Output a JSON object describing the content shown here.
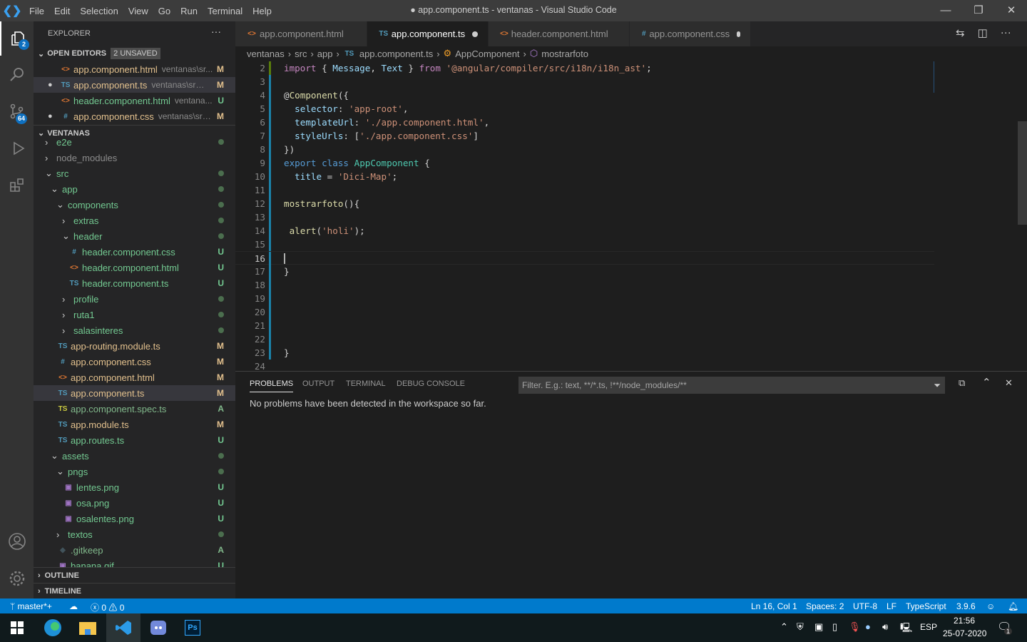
{
  "titlebar": {
    "menus": [
      "File",
      "Edit",
      "Selection",
      "View",
      "Go",
      "Run",
      "Terminal",
      "Help"
    ],
    "title": "● app.component.ts - ventanas - Visual Studio Code"
  },
  "activity": {
    "explorer_badge": "2",
    "scm_badge": "64"
  },
  "sidebar": {
    "title": "EXPLORER",
    "more": "···",
    "open_editors": {
      "label": "OPEN EDITORS",
      "badge": "2 UNSAVED",
      "items": [
        {
          "icon": "<>",
          "iconColor": "#e37933",
          "name": "app.component.html",
          "desc": "ventanas\\sr...",
          "status": "M",
          "color": "#e2c08d",
          "dirty": false
        },
        {
          "icon": "TS",
          "iconColor": "#519aba",
          "name": "app.component.ts",
          "desc": "ventanas\\src\\a...",
          "status": "M",
          "color": "#e2c08d",
          "dirty": true
        },
        {
          "icon": "<>",
          "iconColor": "#e37933",
          "name": "header.component.html",
          "desc": "ventana...",
          "status": "U",
          "color": "#73c991",
          "dirty": false
        },
        {
          "icon": "#",
          "iconColor": "#519aba",
          "name": "app.component.css",
          "desc": "ventanas\\src\\...",
          "status": "M",
          "color": "#e2c08d",
          "dirty": true
        }
      ]
    },
    "workspace": "VENTANAS",
    "tree": [
      {
        "name": "e2e",
        "depth": 1,
        "type": "folder",
        "open": false,
        "color": "#73c991",
        "status": "dot"
      },
      {
        "name": "node_modules",
        "depth": 1,
        "type": "folder",
        "open": false,
        "color": "#8c8c8c",
        "status": ""
      },
      {
        "name": "src",
        "depth": 1,
        "type": "folder",
        "open": true,
        "color": "#73c991",
        "status": "dot"
      },
      {
        "name": "app",
        "depth": 2,
        "type": "folder",
        "open": true,
        "color": "#73c991",
        "status": "dot"
      },
      {
        "name": "components",
        "depth": 3,
        "type": "folder",
        "open": true,
        "color": "#73c991",
        "status": "dot"
      },
      {
        "name": "extras",
        "depth": 4,
        "type": "folder",
        "open": false,
        "color": "#73c991",
        "status": "dot"
      },
      {
        "name": "header",
        "depth": 4,
        "type": "folder",
        "open": true,
        "color": "#73c991",
        "status": "dot"
      },
      {
        "name": "header.component.css",
        "depth": 5,
        "type": "file",
        "icon": "#",
        "iconColor": "#519aba",
        "color": "#73c991",
        "status": "U"
      },
      {
        "name": "header.component.html",
        "depth": 5,
        "type": "file",
        "icon": "<>",
        "iconColor": "#e37933",
        "color": "#73c991",
        "status": "U"
      },
      {
        "name": "header.component.ts",
        "depth": 5,
        "type": "file",
        "icon": "TS",
        "iconColor": "#519aba",
        "color": "#73c991",
        "status": "U"
      },
      {
        "name": "profile",
        "depth": 4,
        "type": "folder",
        "open": false,
        "color": "#73c991",
        "status": "dot"
      },
      {
        "name": "ruta1",
        "depth": 4,
        "type": "folder",
        "open": false,
        "color": "#73c991",
        "status": "dot"
      },
      {
        "name": "salasinteres",
        "depth": 4,
        "type": "folder",
        "open": false,
        "color": "#73c991",
        "status": "dot"
      },
      {
        "name": "app-routing.module.ts",
        "depth": 3,
        "type": "file",
        "icon": "TS",
        "iconColor": "#519aba",
        "color": "#e2c08d",
        "status": "M"
      },
      {
        "name": "app.component.css",
        "depth": 3,
        "type": "file",
        "icon": "#",
        "iconColor": "#519aba",
        "color": "#e2c08d",
        "status": "M"
      },
      {
        "name": "app.component.html",
        "depth": 3,
        "type": "file",
        "icon": "<>",
        "iconColor": "#e37933",
        "color": "#e2c08d",
        "status": "M"
      },
      {
        "name": "app.component.ts",
        "depth": 3,
        "type": "file",
        "icon": "TS",
        "iconColor": "#519aba",
        "color": "#e2c08d",
        "status": "M",
        "selected": true
      },
      {
        "name": "app.component.spec.ts",
        "depth": 3,
        "type": "file",
        "icon": "TS",
        "iconColor": "#cbcb41",
        "color": "#81b88b",
        "status": "A"
      },
      {
        "name": "app.module.ts",
        "depth": 3,
        "type": "file",
        "icon": "TS",
        "iconColor": "#519aba",
        "color": "#e2c08d",
        "status": "M"
      },
      {
        "name": "app.routes.ts",
        "depth": 3,
        "type": "file",
        "icon": "TS",
        "iconColor": "#519aba",
        "color": "#73c991",
        "status": "U"
      },
      {
        "name": "assets",
        "depth": 2,
        "type": "folder",
        "open": true,
        "color": "#73c991",
        "status": "dot"
      },
      {
        "name": "pngs",
        "depth": 3,
        "type": "folder",
        "open": true,
        "color": "#73c991",
        "status": "dot"
      },
      {
        "name": "lentes.png",
        "depth": 4,
        "type": "file",
        "icon": "▣",
        "iconColor": "#a074c4",
        "color": "#73c991",
        "status": "U"
      },
      {
        "name": "osa.png",
        "depth": 4,
        "type": "file",
        "icon": "▣",
        "iconColor": "#a074c4",
        "color": "#73c991",
        "status": "U"
      },
      {
        "name": "osalentes.png",
        "depth": 4,
        "type": "file",
        "icon": "▣",
        "iconColor": "#a074c4",
        "color": "#73c991",
        "status": "U"
      },
      {
        "name": "textos",
        "depth": 3,
        "type": "folder",
        "open": false,
        "color": "#73c991",
        "status": "dot"
      },
      {
        "name": ".gitkeep",
        "depth": 3,
        "type": "file",
        "icon": "◆",
        "iconColor": "#41535b",
        "color": "#81b88b",
        "status": "A"
      },
      {
        "name": "banana.gif",
        "depth": 3,
        "type": "file",
        "icon": "▣",
        "iconColor": "#a074c4",
        "color": "#73c991",
        "status": "U"
      }
    ],
    "outline": "OUTLINE",
    "timeline": "TIMELINE"
  },
  "tabs": [
    {
      "icon": "<>",
      "iconColor": "#e37933",
      "label": "app.component.html",
      "active": false,
      "dirty": false
    },
    {
      "icon": "TS",
      "iconColor": "#519aba",
      "label": "app.component.ts",
      "active": true,
      "dirty": true
    },
    {
      "icon": "<>",
      "iconColor": "#e37933",
      "label": "header.component.html",
      "active": false,
      "dirty": false
    },
    {
      "icon": "#",
      "iconColor": "#519aba",
      "label": "app.component.css",
      "active": false,
      "dirty": true
    }
  ],
  "breadcrumb": [
    "ventanas",
    "src",
    "app",
    "app.component.ts",
    "AppComponent",
    "mostrarfoto"
  ],
  "code": [
    {
      "n": 2,
      "tokens": [
        [
          "import",
          "#c586c0"
        ],
        [
          " { ",
          "#d4d4d4"
        ],
        [
          "Message",
          "#9cdcfe"
        ],
        [
          ", ",
          "#d4d4d4"
        ],
        [
          "Text",
          "#9cdcfe"
        ],
        [
          " } ",
          "#d4d4d4"
        ],
        [
          "from",
          "#c586c0"
        ],
        [
          " ",
          "#d4d4d4"
        ],
        [
          "'@angular/compiler/src/i18n/i18n_ast'",
          "#ce9178"
        ],
        [
          ";",
          "#d4d4d4"
        ]
      ]
    },
    {
      "n": 3,
      "tokens": []
    },
    {
      "n": 4,
      "tokens": [
        [
          "@",
          "#d4d4d4"
        ],
        [
          "Component",
          "#dcdcaa"
        ],
        [
          "({",
          "#d4d4d4"
        ]
      ]
    },
    {
      "n": 5,
      "tokens": [
        [
          "  selector",
          "#9cdcfe"
        ],
        [
          ": ",
          "#d4d4d4"
        ],
        [
          "'app-root'",
          "#ce9178"
        ],
        [
          ",",
          "#d4d4d4"
        ]
      ]
    },
    {
      "n": 6,
      "tokens": [
        [
          "  templateUrl",
          "#9cdcfe"
        ],
        [
          ": ",
          "#d4d4d4"
        ],
        [
          "'./app.component.html'",
          "#ce9178"
        ],
        [
          ",",
          "#d4d4d4"
        ]
      ]
    },
    {
      "n": 7,
      "tokens": [
        [
          "  styleUrls",
          "#9cdcfe"
        ],
        [
          ": [",
          "#d4d4d4"
        ],
        [
          "'./app.component.css'",
          "#ce9178"
        ],
        [
          "]",
          "#d4d4d4"
        ]
      ]
    },
    {
      "n": 8,
      "tokens": [
        [
          "})",
          "#d4d4d4"
        ]
      ]
    },
    {
      "n": 9,
      "tokens": [
        [
          "export",
          "#569cd6"
        ],
        [
          " ",
          "#d4d4d4"
        ],
        [
          "class",
          "#569cd6"
        ],
        [
          " ",
          "#d4d4d4"
        ],
        [
          "AppComponent",
          "#4ec9b0"
        ],
        [
          " {",
          "#d4d4d4"
        ]
      ]
    },
    {
      "n": 10,
      "tokens": [
        [
          "  title",
          "#9cdcfe"
        ],
        [
          " = ",
          "#d4d4d4"
        ],
        [
          "'Dici-Map'",
          "#ce9178"
        ],
        [
          ";",
          "#d4d4d4"
        ]
      ]
    },
    {
      "n": 11,
      "tokens": []
    },
    {
      "n": 12,
      "tokens": [
        [
          "mostrarfoto",
          "#dcdcaa"
        ],
        [
          "(){",
          "#d4d4d4"
        ]
      ]
    },
    {
      "n": 13,
      "tokens": []
    },
    {
      "n": 14,
      "tokens": [
        [
          " alert",
          "#dcdcaa"
        ],
        [
          "(",
          "#d4d4d4"
        ],
        [
          "'holi'",
          "#ce9178"
        ],
        [
          ");",
          "#d4d4d4"
        ]
      ]
    },
    {
      "n": 15,
      "tokens": []
    },
    {
      "n": 16,
      "tokens": []
    },
    {
      "n": 17,
      "tokens": [
        [
          "}",
          "#d4d4d4"
        ]
      ]
    },
    {
      "n": 18,
      "tokens": []
    },
    {
      "n": 19,
      "tokens": []
    },
    {
      "n": 20,
      "tokens": []
    },
    {
      "n": 21,
      "tokens": []
    },
    {
      "n": 22,
      "tokens": []
    },
    {
      "n": 23,
      "tokens": [
        [
          "}",
          "#d4d4d4"
        ]
      ]
    },
    {
      "n": 24,
      "tokens": []
    }
  ],
  "panel": {
    "tabs": [
      "PROBLEMS",
      "OUTPUT",
      "TERMINAL",
      "DEBUG CONSOLE"
    ],
    "filter_placeholder": "Filter. E.g.: text, **/*.ts, !**/node_modules/**",
    "message": "No problems have been detected in the workspace so far."
  },
  "statusbar": {
    "branch": "master*+",
    "errors": "0",
    "warnings": "0",
    "position": "Ln 16, Col 1",
    "spaces": "Spaces: 2",
    "encoding": "UTF-8",
    "eol": "LF",
    "language": "TypeScript",
    "version": "3.9.6"
  },
  "taskbar": {
    "lang": "ESP",
    "time": "21:56",
    "date": "25-07-2020",
    "notifications": "1"
  }
}
